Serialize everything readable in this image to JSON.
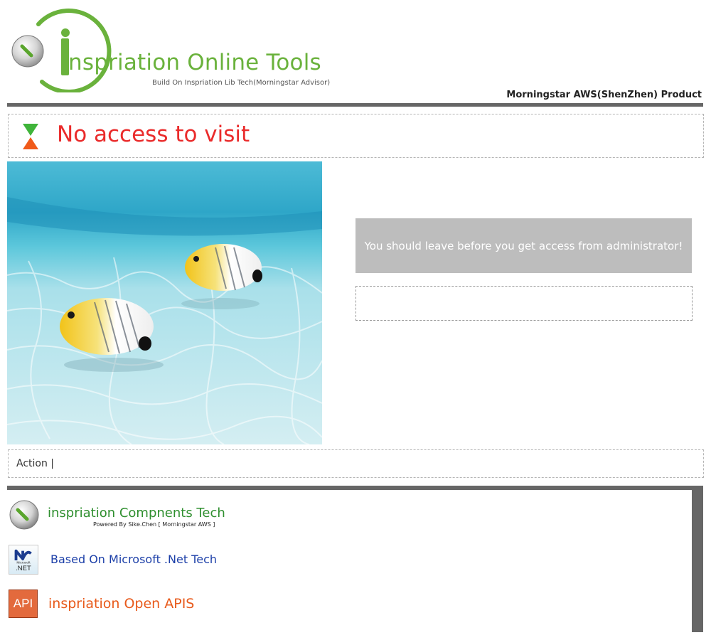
{
  "header": {
    "brand_title": "nspriation Online Tools",
    "brand_subtitle": "Build On Inspriation Lib Tech(Morningstar Advisor)",
    "product_label": "Morningstar AWS(ShenZhen) Product"
  },
  "notice": {
    "title": "No access to visit",
    "message": "You should leave before you get access from administrator!",
    "detail": ""
  },
  "action_bar": {
    "text": "Action |"
  },
  "footer": {
    "items": [
      {
        "label": "inspriation Compnents Tech",
        "sub": "Powered By Sike.Chen [ Morningstar AWS ]",
        "icon": "inspiration-logo-icon"
      },
      {
        "label": "Based On Microsoft .Net Tech",
        "icon": "dotnet-icon",
        "icon_text_top": "Microsoft",
        "icon_text_bottom": ".NET"
      },
      {
        "label": "inspriation Open APIS",
        "icon": "api-icon",
        "icon_text": "API"
      }
    ]
  },
  "colors": {
    "brand_green": "#6ab23c",
    "notice_red": "#ea2b2b",
    "message_gray": "#bdbdbd",
    "rule_gray": "#666666",
    "footer_green": "#2f8f2f",
    "footer_blue": "#1c3fa8",
    "footer_orange": "#e85a1b"
  },
  "image": {
    "subject": "two butterflyfish swimming over sandy sea floor"
  }
}
